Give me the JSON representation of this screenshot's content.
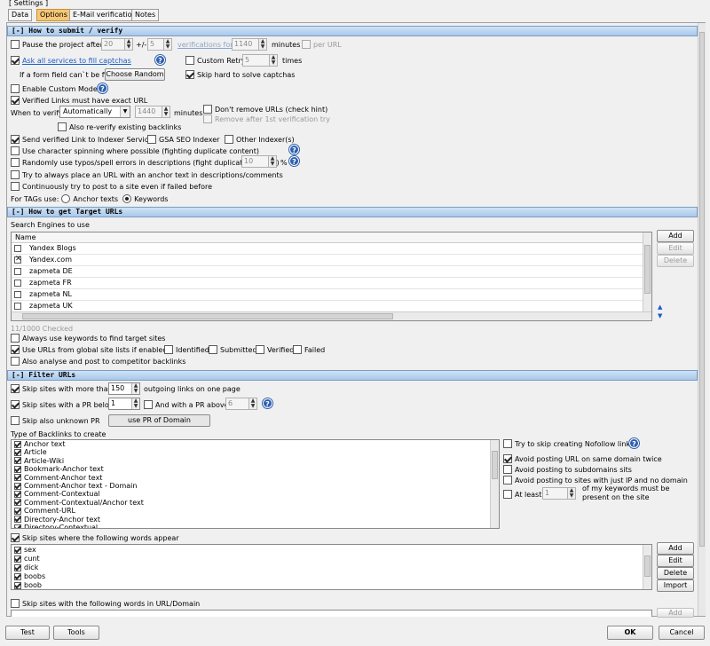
{
  "window": {
    "title": "[ Settings ]"
  },
  "tabs": [
    {
      "label": "Data",
      "active": false
    },
    {
      "label": "Options",
      "active": true
    },
    {
      "label": "E-Mail verification",
      "active": false
    },
    {
      "label": "Notes",
      "active": false
    }
  ],
  "submit": {
    "header": "[-] How to submit / verify",
    "pause_label": "Pause the project after",
    "pause_value": "20",
    "pm_label": "+/-",
    "pm_value": "5",
    "verifications_for_label": "verifications for",
    "minutes_value": "1140",
    "minutes_label": "minutes",
    "per_url_label": "per URL",
    "ask_all_label": "Ask all services to fill captchas",
    "custom_retry_label": "Custom Retry",
    "retry_value": "5",
    "times_label": "times",
    "form_field_label": "If a form field can`t be filled",
    "choose_random_label": "Choose Random",
    "skip_hard_label": "Skip hard to solve captchas",
    "custom_mode_label": "Enable Custom Mode",
    "verified_exact_label": "Verified Links must have exact URL",
    "when_verify_label": "When to verify",
    "when_verify_value": "Automatically",
    "verify_minutes_value": "1440",
    "verify_minutes_label": "minutes",
    "dont_remove_label": "Don't remove URLs (check hint)",
    "remove_after_label": "Remove after 1st verification try",
    "reverify_label": "Also re-verify existing backlinks",
    "send_indexer_label": "Send verified Link to Indexer Services",
    "gsa_indexer_label": "GSA SEO Indexer",
    "other_indexer_label": "Other Indexer(s)",
    "char_spinning_label": "Use character spinning where possible (fighting duplicate content)",
    "typos_label": "Randomly use typos/spell errors in descriptions (fight duplicate content)",
    "typos_value": "10",
    "percent_label": "%",
    "anchor_url_label": "Try to always place an URL with an anchor text in descriptions/comments",
    "continuously_label": "Continuously try to post to a site even if failed before",
    "tags_label": "For TAGs use:",
    "anchor_texts_label": "Anchor texts",
    "keywords_label": "Keywords"
  },
  "target": {
    "header": "[-] How to get Target URLs",
    "search_engines_label": "Search Engines to use",
    "name_col": "Name",
    "engines": [
      {
        "name": "Yandex Blogs",
        "state": "off"
      },
      {
        "name": "Yandex.com",
        "state": "x"
      },
      {
        "name": "zapmeta DE",
        "state": "off"
      },
      {
        "name": "zapmeta FR",
        "state": "off"
      },
      {
        "name": "zapmeta NL",
        "state": "off"
      },
      {
        "name": "zapmeta UK",
        "state": "off"
      }
    ],
    "add_label": "Add",
    "edit_label": "Edit",
    "delete_label": "Delete",
    "checked_count": "11/1000 Checked",
    "always_keywords_label": "Always use keywords to find target sites",
    "global_lists_label": "Use URLs from global site lists if enabled",
    "identified_label": "Identified",
    "submitted_label": "Submitted",
    "verified_label": "Verified",
    "failed_label": "Failed",
    "competitor_label": "Also analyse and post to competitor backlinks"
  },
  "filter": {
    "header": "[-] Filter URLs",
    "skip_more_label": "Skip sites with more than",
    "outgoing_value": "150",
    "outgoing_label": "outgoing links on one page",
    "skip_pr_below_label": "Skip sites with a PR below",
    "pr_below_value": "1",
    "and_pr_above_label": "And with a PR above",
    "pr_above_value": "6",
    "skip_unknown_pr_label": "Skip also unknown PR",
    "use_pr_domain_label": "use PR of Domain",
    "backlink_types_label": "Type of Backlinks to create",
    "backlink_types": [
      "Anchor text",
      "Article",
      "Article-Wiki",
      "Bookmark-Anchor text",
      "Comment-Anchor text",
      "Comment-Anchor text - Domain",
      "Comment-Contextual",
      "Comment-Contextual/Anchor text",
      "Comment-URL",
      "Directory-Anchor text",
      "Directory-Contextual"
    ],
    "nofollow_label": "Try to skip creating Nofollow links",
    "avoid_same_domain_label": "Avoid posting URL on same domain twice",
    "avoid_subdomain_label": "Avoid posting to subdomains sits",
    "avoid_ip_label": "Avoid posting to sites with just IP and no domain",
    "at_least_label": "At least",
    "at_least_value": "1",
    "keywords_present_label": "of my keywords must be present on the site",
    "skip_words_label": "Skip sites where the following words appear",
    "bad_words": [
      "sex",
      "cunt",
      "dick",
      "boobs",
      "boob"
    ],
    "add_label": "Add",
    "edit_label": "Edit",
    "delete_label": "Delete",
    "import_label": "Import",
    "skip_url_words_label": "Skip sites with the following words in URL/Domain",
    "add2_label": "Add"
  },
  "footer": {
    "test_label": "Test",
    "tools_label": "Tools",
    "ok_label": "OK",
    "cancel_label": "Cancel"
  }
}
